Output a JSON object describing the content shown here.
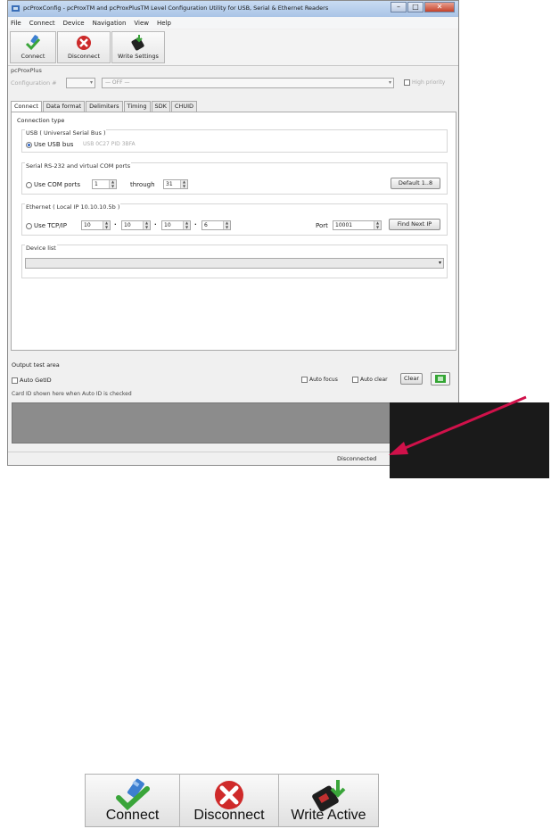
{
  "window": {
    "title": "pcProxConfig - pcProxTM and pcProxPlusTM Level Configuration Utility for USB, Serial & Ethernet Readers",
    "controls": {
      "minimize": "–",
      "maximize": "□",
      "close": "✕"
    }
  },
  "menu": [
    "File",
    "Connect",
    "Device",
    "Navigation",
    "View",
    "Help"
  ],
  "toolbar": {
    "connect": "Connect",
    "disconnect": "Disconnect",
    "write_settings": "Write Settings"
  },
  "device_name": "pcProxPlus",
  "config": {
    "label": "Configuration #",
    "selector_value": "— OFF —",
    "high_priority": "High priority"
  },
  "tabs": [
    "Connect",
    "Data format",
    "Delimiters",
    "Timing",
    "SDK",
    "CHUID"
  ],
  "connect_tab": {
    "connection_type": "Connection type",
    "usb": {
      "group": "USB ( Universal Serial Bus )",
      "option": "Use USB bus",
      "note": "USB 0C27 PID 3BFA"
    },
    "serial": {
      "group": "Serial RS-232 and virtual COM ports",
      "option": "Use COM ports",
      "from": "1",
      "through_label": "through",
      "to": "31",
      "default_btn": "Default 1..8"
    },
    "ethernet": {
      "group": "Ethernet ( Local IP 10.10.10.5b )",
      "option": "Use TCP/IP",
      "ip": [
        "10",
        "10",
        "10",
        "6"
      ],
      "port_label": "Port",
      "port": "10001",
      "find_btn": "Find Next IP"
    },
    "device_list": "Device list"
  },
  "output": {
    "label": "Output test area",
    "auto_getid": "Auto GetID",
    "auto_focus": "Auto focus",
    "auto_clear": "Auto clear",
    "clear_btn": "Clear",
    "hint": "Card ID shown here when Auto ID is checked"
  },
  "status": "Disconnected",
  "zoomed_toolbar": {
    "connect": "Connect",
    "disconnect": "Disconnect",
    "write_active": "Write Active"
  },
  "colors": {
    "arrow": "#d0114a",
    "callout": "#1a1a1a",
    "output_area": "#8c8c8c"
  }
}
